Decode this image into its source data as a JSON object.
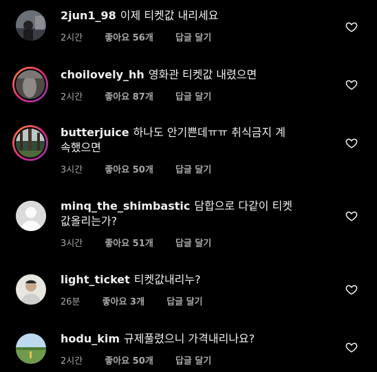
{
  "comments": [
    {
      "username": "2jun1_98",
      "text": "이제 티켓값 내리세요",
      "time": "2시간",
      "likes": "좋아요 56개",
      "reply": "답글 달기"
    },
    {
      "username": "choilovely_hh",
      "text": "영화관 티켓값  내렸으면",
      "time": "2시간",
      "likes": "좋아요 87개",
      "reply": "답글 달기"
    },
    {
      "username": "butterjuice",
      "text": "하나도 안기쁜데ㅠㅠ 취식금지 계속했으면",
      "time": "3시간",
      "likes": "좋아요 50개",
      "reply": "답글 달기"
    },
    {
      "username": "minq_the_shimbastic",
      "text": "담합으로 다같이 티켓값올리는가?",
      "time": "3시간",
      "likes": "좋아요 51개",
      "reply": "답글 달기"
    },
    {
      "username": "light_ticket",
      "text": "티켓값내리누?",
      "time": "26분",
      "likes": "좋아요 3개",
      "reply": "답글 달기"
    },
    {
      "username": "hodu_kim",
      "text": "규제풀렸으니 가격내리나요?",
      "time": "2시간",
      "likes": "좋아요 50개",
      "reply": "답글 달기"
    }
  ],
  "icons": {
    "like": "heart-outline-icon",
    "avatar_placeholder": "user-silhouette-icon"
  },
  "colors": {
    "background": "#000000",
    "text": "#f5f5f5",
    "meta": "#a8a8a8",
    "story_ring": "#dd2a7b"
  }
}
